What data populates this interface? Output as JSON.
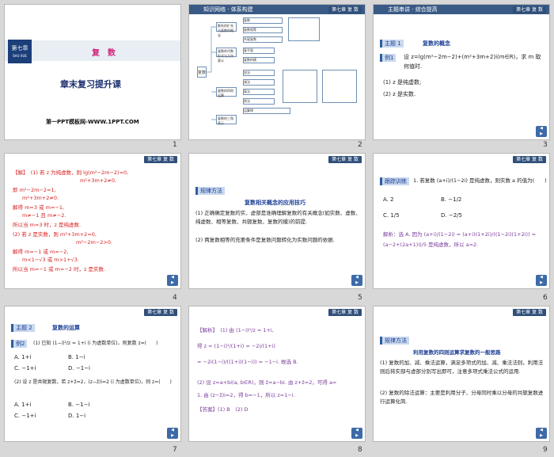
{
  "slides": [
    {
      "num": "1",
      "chapter_badge": "第七章",
      "chapter_sub": "SHU XUE",
      "title": "复　数",
      "subtitle": "章末复习提升课",
      "watermark": "第一PPT模板网-WWW.1PPT.COM"
    },
    {
      "num": "2",
      "bar_title": "知识网络",
      "bar_sub": "体系构建",
      "tag": "第七章 复 数"
    },
    {
      "num": "3",
      "bar_title": "主题串讲",
      "bar_sub": "综合提高",
      "tag": "第七章 复 数",
      "theme_label": "主题",
      "theme_num": "1",
      "theme_title": "复数的概念",
      "example": "例1",
      "problem": "设 z=lg(m²−2m−2)+(m²+3m+2)i(m∈R)，求 m 取何值时.",
      "q1": "(1) z 是纯虚数;",
      "q2": "(2) z 是实数."
    },
    {
      "num": "4",
      "tag": "第七章 复 数",
      "lines": [
        "【解】　(1) 若 z 为纯虚数，则 lg(m²−2m−2)=0,",
        "m²+3m+2≠0.",
        "即 m²−2m−2=1,",
        "m²+3m+2≠0.",
        "解得 m=3 或 m=−1,",
        "m≠−1 且 m≠−2.",
        "所以当 m=3 时，z 是纯虚数.",
        "(2) 若 z 是实数，则 m²+3m+2=0,",
        "m²−2m−2>0.",
        "解得 m=−1 或 m=−2,",
        "m<1−√3 或 m>1+√3.",
        "所以当 m=−1 或 m=−2 时，z 是实数."
      ]
    },
    {
      "num": "5",
      "tag": "第七章 复 数",
      "label": "规律方法",
      "heading": "复数相关概念的应用技巧",
      "p1": "(1) 正确确定复数的实、虚部是准确理解复数的有关概念(如实数、虚数、纯虚数、相等复数、共轭复数、复数的模)的前提.",
      "p2": "(2) 两复数相等的充要条件是复数问题转化为实数问题的依据."
    },
    {
      "num": "6",
      "tag": "第七章 复 数",
      "label": "跟踪训练",
      "problem": "1. 若复数 (a+i)/(1−2i) 是纯虚数，则实数 a 的值为(　　)",
      "optA": "A. 2",
      "optB": "B. −1/2",
      "optC": "C. 1/5",
      "optD": "D. −2/5",
      "solution": "解析：选 A. 因为 (a+i)/(1−2i) = (a+i)(1+2i)/((1−2i)(1+2i)) = (a−2+(2a+1)i)/5 是纯虚数，所以 a=2."
    },
    {
      "num": "7",
      "tag": "第七章 复 数",
      "theme_label": "主题",
      "theme_num": "2",
      "theme_title": "复数的运算",
      "example": "例2",
      "q1": "(1) 已知 (1−i)²/z = 1+i (i 为虚数单位)，则复数 z=(　　)",
      "q1A": "A. 1+i",
      "q1B": "B. 1−i",
      "q1C": "C. −1+i",
      "q1D": "D. −1−i",
      "q2": "(2) 设 z 是共轭复数，若 z+z̄=2，(z−z̄)i=2 (i 为虚数单位)，则 z=(　　)",
      "q2A": "A. 1+i",
      "q2B": "B. −1−i",
      "q2C": "C. −1+i",
      "q2D": "D. 1−i"
    },
    {
      "num": "8",
      "tag": "第七章 复 数",
      "lines": [
        "【解析】　(1) 由 (1−i)²/z = 1+i,",
        "得 z = (1−i)²/(1+i) = −2i/(1+i)",
        "= −2i(1−i)/((1+i)(1−i)) = −1−i. 故选 B.",
        "(2) 设 z=a+bi(a, b∈R)，则 z̄=a−bi. 由 z+z̄=2，可得 a=",
        "1. 由 (z−z̄)i=2，得 b=−1，所以 z=1−i.",
        "【答案】(1) B　(2) D"
      ]
    },
    {
      "num": "9",
      "tag": "第七章 复 数",
      "label": "规律方法",
      "heading": "利用复数的四则运算求复数的一般思路",
      "p1": "(1) 复数的加、减、乘法运算，满足多项式的加、减、乘法法则，利用法则后将实部与虚部分别写出即可，注意多项式乘法公式的运用.",
      "p2": "(2) 复数的除法运算：主要是利用分子、分母同时乘以分母的共轭复数进行运算化简."
    }
  ],
  "mindmap": {
    "root": "复数",
    "branches": [
      "数系的扩充与复数的概念",
      "复数的代数形式与几何意义",
      "复数的四则运算",
      "复数的三角表示"
    ],
    "leaves": [
      "复数",
      "复数相等",
      "共轭复数",
      "复平面",
      "复数的模",
      "加法",
      "减法",
      "乘法",
      "除法",
      "运算律"
    ]
  },
  "footer_pages": {
    "p1": "1",
    "p2": "2",
    "p3": "3"
  }
}
